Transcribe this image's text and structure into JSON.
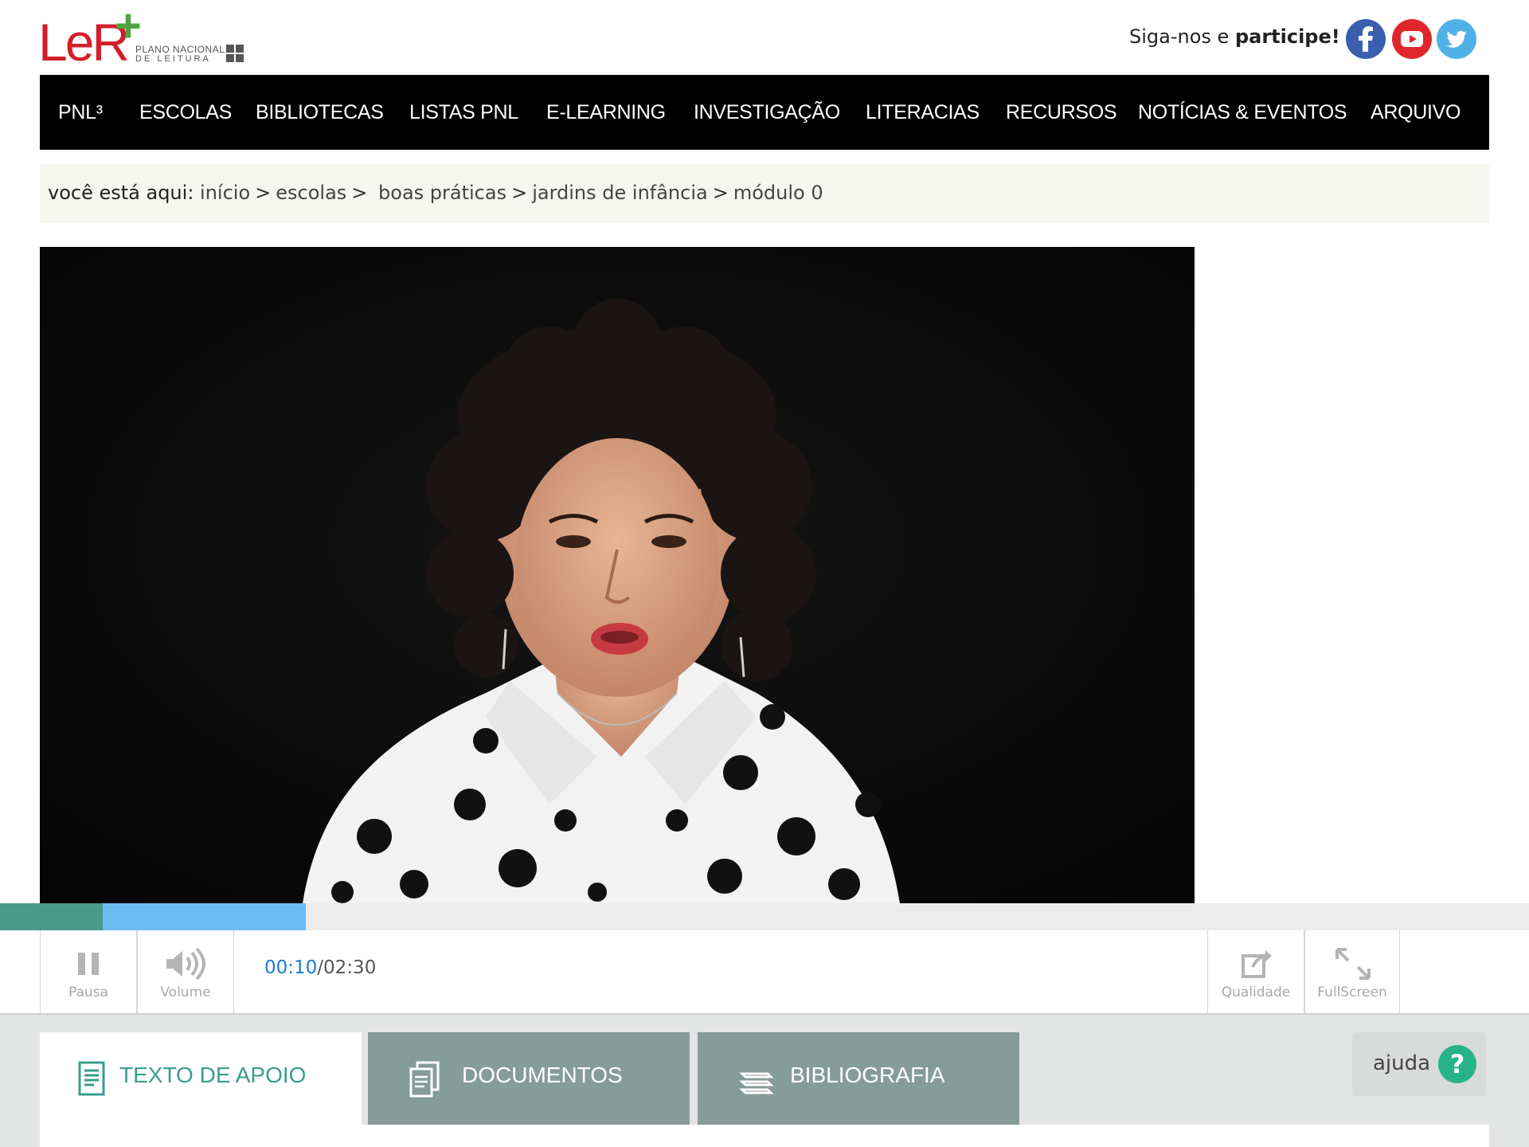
{
  "logo": {
    "wordmark": "LeR",
    "line1": "PLANO NACIONAL",
    "line2": "DE LEITURA"
  },
  "social": {
    "follow_prefix": "Siga-nos e",
    "follow_bold": "participe!",
    "icons": [
      "facebook-icon",
      "youtube-icon",
      "twitter-icon"
    ]
  },
  "nav": {
    "items": [
      "PNL³",
      "ESCOLAS",
      "BIBLIOTECAS",
      "LISTAS PNL",
      "E-LEARNING",
      "INVESTIGAÇÃO",
      "LITERACIAS",
      "RECURSOS",
      "NOTÍCIAS & EVENTOS",
      "ARQUIVO"
    ]
  },
  "breadcrumb": {
    "label": "você está aqui:",
    "items": [
      "início",
      "escolas",
      "boas práticas",
      "jardins de infância",
      "módulo 0"
    ],
    "separator": ">"
  },
  "player": {
    "progress": {
      "played_fraction": 0.067,
      "buffered_fraction": 0.2
    },
    "pause_label": "Pausa",
    "volume_label": "Volume",
    "current_time": "00:10",
    "duration": "/02:30",
    "quality_label": "Qualidade",
    "fullscreen_label": "FullScreen"
  },
  "tabs": {
    "support_text": "TEXTO DE APOIO",
    "documents": "DOCUMENTOS",
    "bibliography": "BIBLIOGRAFIA",
    "help_label": "ajuda",
    "help_glyph": "?"
  },
  "colors": {
    "brand_red": "#d21f2a",
    "brand_green": "#4ca53f",
    "nav_bg": "#000000",
    "accent_teal": "#3a9d8c",
    "progress_played": "#4a9a89",
    "progress_buffered": "#6bbcf5",
    "tab_inactive": "#869c98",
    "time_blue": "#1f7bd0"
  }
}
